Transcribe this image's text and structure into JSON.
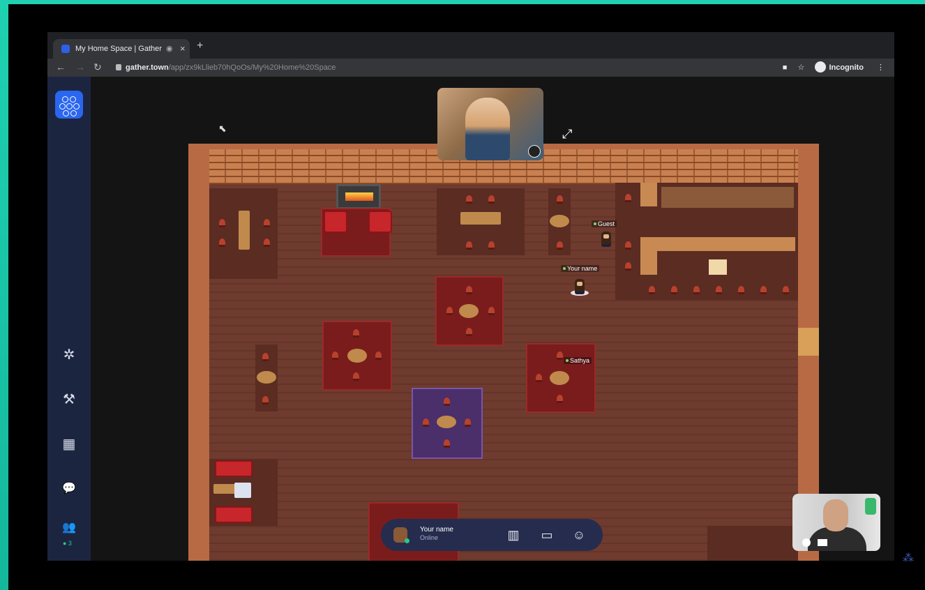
{
  "browser": {
    "tab_title": "My Home Space | Gather",
    "tab_close": "×",
    "new_tab": "+",
    "url_host": "gather.town",
    "url_path": "/app/zx9kLlieb70hQoOs/My%20Home%20Space",
    "profile_label": "Incognito"
  },
  "sidebar": {
    "items": [
      {
        "icon": "settings-icon",
        "glyph": "✲"
      },
      {
        "icon": "hammer-icon",
        "glyph": "⚒"
      },
      {
        "icon": "calendar-icon",
        "glyph": "▦"
      },
      {
        "icon": "chat-icon",
        "glyph": "💬"
      },
      {
        "icon": "participants-icon",
        "glyph": "👥"
      }
    ],
    "participant_count": "● 3"
  },
  "map": {
    "players": [
      {
        "name": "Guest"
      },
      {
        "name": "Your name"
      },
      {
        "name": "Sathya"
      }
    ]
  },
  "bottom_bar": {
    "user_name": "Your name",
    "user_status": "Online",
    "icons": [
      "map-icon",
      "screen-share-icon",
      "emoji-icon"
    ]
  },
  "colors": {
    "accent_teal": "#1fd1b0",
    "sidebar": "#1c2540",
    "gather_blue": "#2a66f0",
    "floor": "#6e3b2e",
    "rug_red": "#7a1c1c",
    "rug_purple": "#4a2f6a",
    "online_green": "#27c98f"
  }
}
